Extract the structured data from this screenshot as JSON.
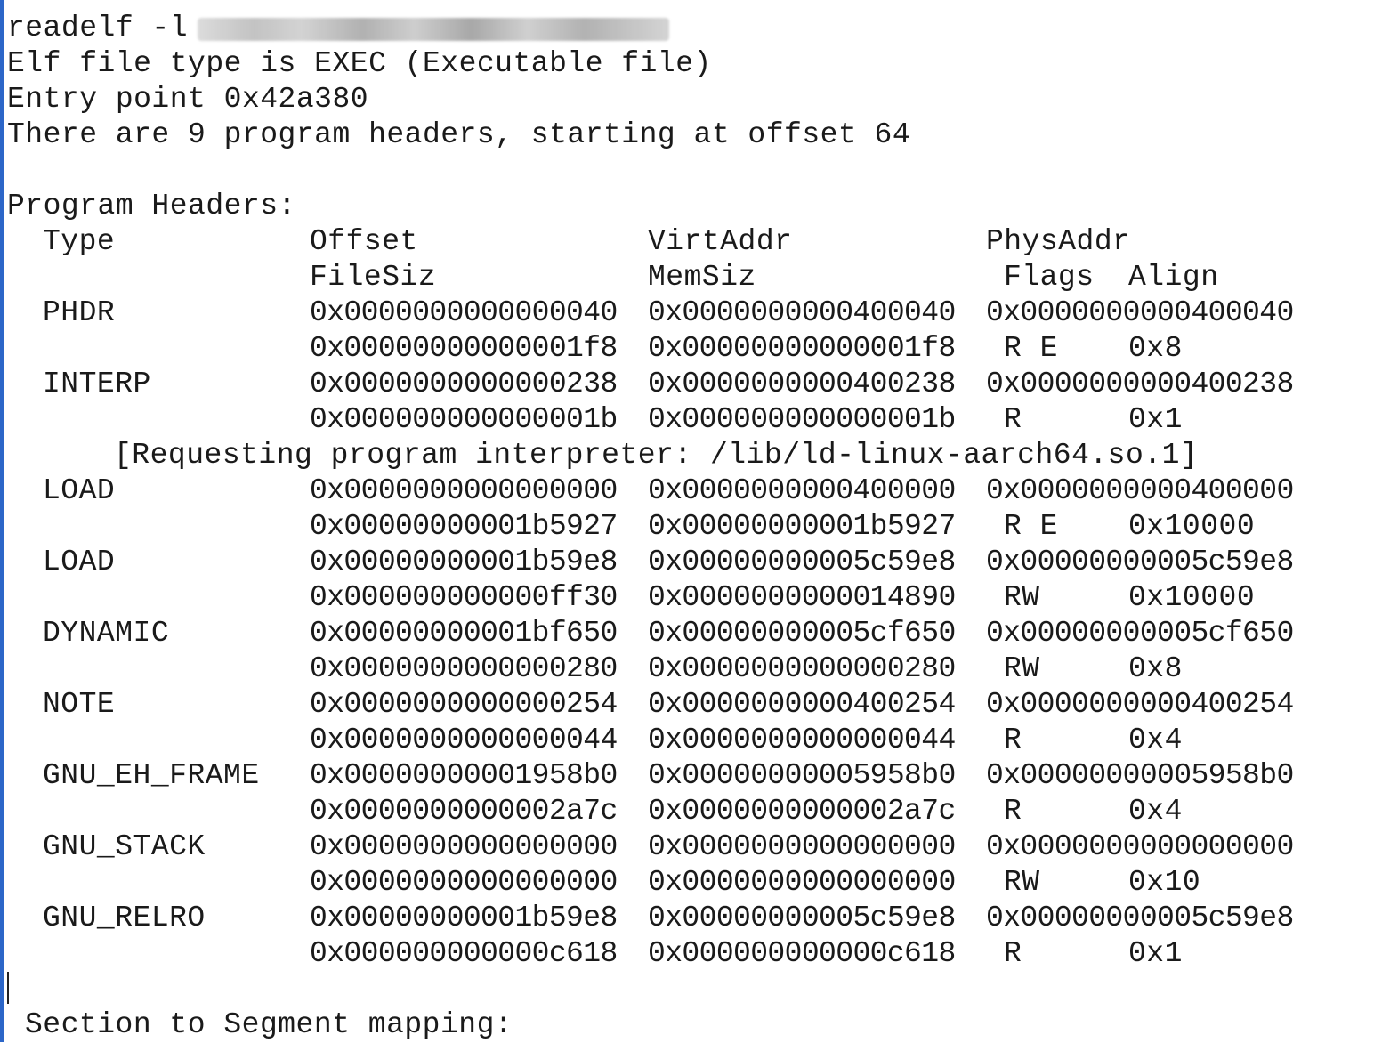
{
  "command": {
    "text": "readelf -l",
    "redacted_arg": ""
  },
  "intro": [
    "Elf file type is EXEC (Executable file)",
    "Entry point 0x42a380",
    "There are 9 program headers, starting at offset 64"
  ],
  "program_headers_title": "Program Headers:",
  "columns": {
    "type": "Type",
    "offset": "Offset",
    "virtaddr": "VirtAddr",
    "physaddr": "PhysAddr",
    "filesiz": "FileSiz",
    "memsiz": "MemSiz",
    "flags": "Flags",
    "align": "Align"
  },
  "headers": [
    {
      "type": "PHDR",
      "offset": "0x0000000000000040",
      "virtaddr": "0x0000000000400040",
      "physaddr": "0x0000000000400040",
      "filesiz": "0x00000000000001f8",
      "memsiz": "0x00000000000001f8",
      "flags": "R E",
      "align": "0x8"
    },
    {
      "type": "INTERP",
      "offset": "0x0000000000000238",
      "virtaddr": "0x0000000000400238",
      "physaddr": "0x0000000000400238",
      "filesiz": "0x000000000000001b",
      "memsiz": "0x000000000000001b",
      "flags": "R",
      "align": "0x1",
      "note": "[Requesting program interpreter: /lib/ld-linux-aarch64.so.1]"
    },
    {
      "type": "LOAD",
      "offset": "0x0000000000000000",
      "virtaddr": "0x0000000000400000",
      "physaddr": "0x0000000000400000",
      "filesiz": "0x00000000001b5927",
      "memsiz": "0x00000000001b5927",
      "flags": "R E",
      "align": "0x10000"
    },
    {
      "type": "LOAD",
      "offset": "0x00000000001b59e8",
      "virtaddr": "0x00000000005c59e8",
      "physaddr": "0x00000000005c59e8",
      "filesiz": "0x000000000000ff30",
      "memsiz": "0x0000000000014890",
      "flags": "RW",
      "align": "0x10000"
    },
    {
      "type": "DYNAMIC",
      "offset": "0x00000000001bf650",
      "virtaddr": "0x00000000005cf650",
      "physaddr": "0x00000000005cf650",
      "filesiz": "0x0000000000000280",
      "memsiz": "0x0000000000000280",
      "flags": "RW",
      "align": "0x8"
    },
    {
      "type": "NOTE",
      "offset": "0x0000000000000254",
      "virtaddr": "0x0000000000400254",
      "physaddr": "0x0000000000400254",
      "filesiz": "0x0000000000000044",
      "memsiz": "0x0000000000000044",
      "flags": "R",
      "align": "0x4"
    },
    {
      "type": "GNU_EH_FRAME",
      "offset": "0x00000000001958b0",
      "virtaddr": "0x00000000005958b0",
      "physaddr": "0x00000000005958b0",
      "filesiz": "0x0000000000002a7c",
      "memsiz": "0x0000000000002a7c",
      "flags": "R",
      "align": "0x4"
    },
    {
      "type": "GNU_STACK",
      "offset": "0x0000000000000000",
      "virtaddr": "0x0000000000000000",
      "physaddr": "0x0000000000000000",
      "filesiz": "0x0000000000000000",
      "memsiz": "0x0000000000000000",
      "flags": "RW",
      "align": "0x10"
    },
    {
      "type": "GNU_RELRO",
      "offset": "0x00000000001b59e8",
      "virtaddr": "0x00000000005c59e8",
      "physaddr": "0x00000000005c59e8",
      "filesiz": "0x000000000000c618",
      "memsiz": "0x000000000000c618",
      "flags": "R",
      "align": "0x1"
    }
  ],
  "section_mapping_title": "Section to Segment mapping:"
}
